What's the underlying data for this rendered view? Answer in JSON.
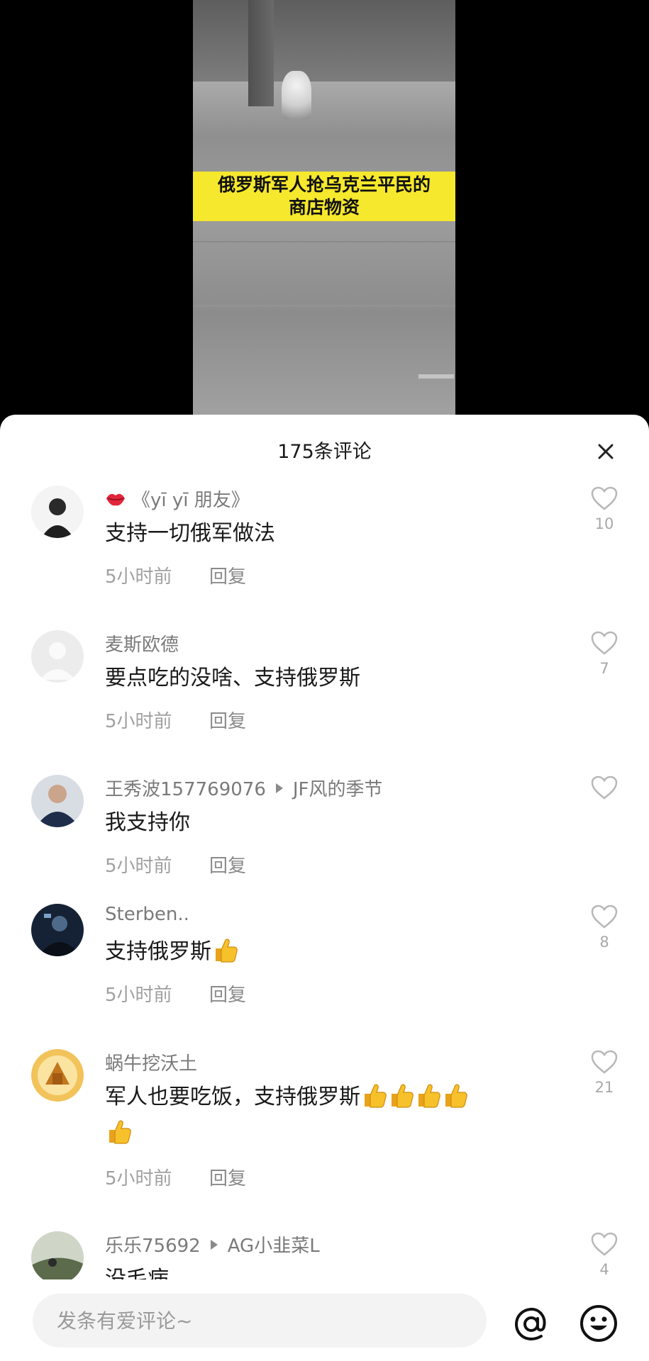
{
  "video": {
    "caption_line1": "俄罗斯军人抢乌克兰平民的",
    "caption_line2": "商店物资"
  },
  "comments_panel": {
    "title": "175条评论",
    "close_icon": "close-icon"
  },
  "comments": [
    {
      "name": "《yī yī 朋友》",
      "name_icon": "lips-icon",
      "text": "支持一切俄军做法",
      "time": "5小时前",
      "reply": "回复",
      "likes": "10"
    },
    {
      "name": "麦斯欧德",
      "text": "要点吃的没啥、支持俄罗斯",
      "time": "5小时前",
      "reply": "回复",
      "likes": "7"
    },
    {
      "name": "王秀波157769076",
      "reply_to": "JF风的季节",
      "text": "我支持你",
      "time": "5小时前",
      "reply": "回复",
      "likes": ""
    },
    {
      "name": "Sterben..",
      "text": "支持俄罗斯",
      "emoji_count": 1,
      "time": "5小时前",
      "reply": "回复",
      "likes": "8"
    },
    {
      "name": "蜗牛挖沃土",
      "text": "军人也要吃饭，支持俄罗斯",
      "emoji_count": 5,
      "time": "5小时前",
      "reply": "回复",
      "likes": "21"
    },
    {
      "name": "乐乐75692",
      "reply_to": "AG小韭菜L",
      "text": "没毛病",
      "likes": "4"
    }
  ],
  "input_bar": {
    "placeholder": "发条有爱评论~",
    "at_icon": "at-icon",
    "emoji_icon": "emoji-icon"
  },
  "colors": {
    "caption_bg": "#f6e82c",
    "panel_bg": "#ffffff",
    "text_primary": "#1a1a1a",
    "text_secondary": "#7a7a7a",
    "text_muted": "#a0a0a0"
  }
}
